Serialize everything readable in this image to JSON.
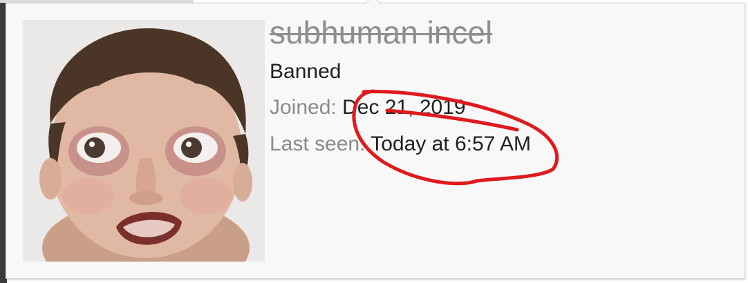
{
  "profile": {
    "username": "subhuman incel",
    "user_title": "Banned",
    "joined_label": "Joined:",
    "joined_value": "Dec 21, 2019",
    "last_seen_label": "Last seen:",
    "last_seen_value": "Today at 6:57 AM"
  },
  "colors": {
    "tooltip_bg": "#f8f8f8",
    "username_struck": "#8e8e8e",
    "label": "#8a8a8a",
    "value": "#1f1f1f",
    "annotation": "#e0191c"
  }
}
